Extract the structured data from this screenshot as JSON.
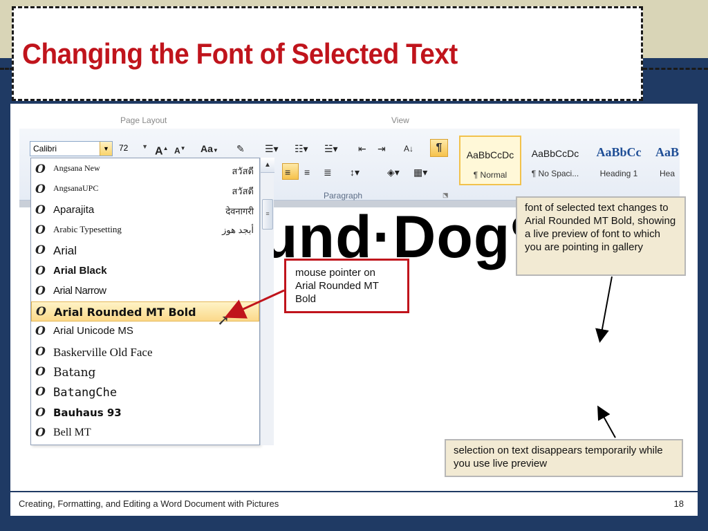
{
  "slide": {
    "title": "Changing the Font of Selected Text",
    "footer": "Creating, Formatting, and Editing a Word Document with Pictures",
    "page_number": "18"
  },
  "ribbon": {
    "tabs": [
      "Page Layout",
      "View"
    ],
    "font_name": "Calibri",
    "font_size": "72",
    "grow_font": "A",
    "shrink_font": "A",
    "change_case": "Aa",
    "paragraph_label": "Paragraph",
    "show_hide": "¶",
    "styles": [
      {
        "sample": "AaBbCcDc",
        "name": "¶ Normal"
      },
      {
        "sample": "AaBbCcDc",
        "name": "¶ No Spaci..."
      },
      {
        "sample": "AaBbCc",
        "name": "Heading 1"
      },
      {
        "sample": "AaB",
        "name": "Hea"
      }
    ]
  },
  "font_list": [
    {
      "name": "Angsana New",
      "sample": "สวัสดี"
    },
    {
      "name": "AngsanaUPC",
      "sample": "สวัสดี"
    },
    {
      "name": "Aparajita",
      "sample": "देवनागरी"
    },
    {
      "name": "Arabic Typesetting",
      "sample": "أبجد هوز"
    },
    {
      "name": "Arial",
      "sample": ""
    },
    {
      "name": "Arial Black",
      "sample": ""
    },
    {
      "name": "Arial Narrow",
      "sample": ""
    },
    {
      "name": "Arial Rounded MT Bold",
      "sample": ""
    },
    {
      "name": "Arial Unicode MS",
      "sample": ""
    },
    {
      "name": "Baskerville Old Face",
      "sample": ""
    },
    {
      "name": "Batang",
      "sample": ""
    },
    {
      "name": "BatangChe",
      "sample": ""
    },
    {
      "name": "Bauhaus 93",
      "sample": ""
    },
    {
      "name": "Bell MT",
      "sample": ""
    }
  ],
  "hovered_font": "Arial Rounded MT Bold",
  "document_text": "und·Dog¶",
  "callouts": {
    "pointer": "mouse pointer on Arial Rounded MT Bold",
    "live_preview": "font of selected text changes to Arial Rounded MT Bold, showing a live preview of font to which you are pointing in gallery",
    "selection": "selection on text disappears temporarily while you use live preview"
  },
  "icons": [
    "font-type-icon",
    "mouse-pointer-icon",
    "scroll-up-arrow-icon",
    "pilcrow-icon"
  ],
  "colors": {
    "title_red": "#c0141c",
    "navy": "#1f3a64",
    "khaki": "#d9d5b7",
    "highlight": "#fbd98a",
    "callout_tan": "#f2ead3"
  }
}
